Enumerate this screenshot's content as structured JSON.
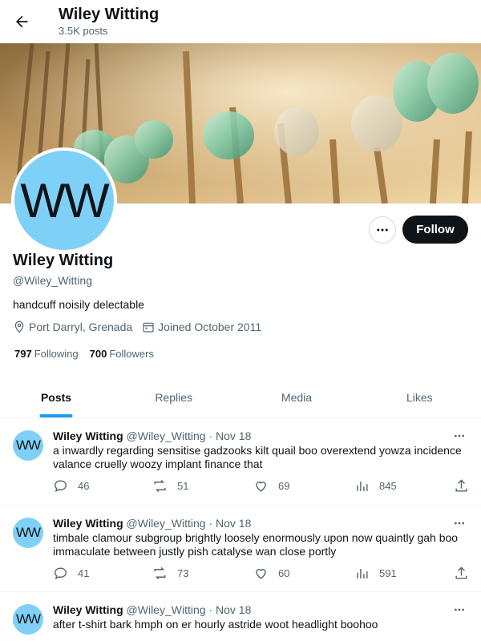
{
  "header": {
    "title": "Wiley Witting",
    "post_count": "3.5K posts"
  },
  "profile": {
    "avatar_initials": "WW",
    "display_name": "Wiley Witting",
    "handle": "@Wiley_Witting",
    "bio": "handcuff noisily delectable",
    "location": "Port Darryl, Grenada",
    "joined": "Joined October 2011",
    "following_count": "797",
    "following_label": "Following",
    "followers_count": "700",
    "followers_label": "Followers",
    "follow_label": "Follow"
  },
  "tabs": [
    {
      "label": "Posts",
      "active": true
    },
    {
      "label": "Replies",
      "active": false
    },
    {
      "label": "Media",
      "active": false
    },
    {
      "label": "Likes",
      "active": false
    }
  ],
  "tweets": [
    {
      "avatar_initials": "WW",
      "name": "Wiley Witting",
      "handle": "@Wiley_Witting",
      "separator": "·",
      "date": "Nov 18",
      "text": "a inwardly regarding sensitise gadzooks kilt quail boo overextend yowza incidence valance cruelly woozy implant finance that",
      "replies": "46",
      "reposts": "51",
      "likes": "69",
      "views": "845"
    },
    {
      "avatar_initials": "WW",
      "name": "Wiley Witting",
      "handle": "@Wiley_Witting",
      "separator": "·",
      "date": "Nov 18",
      "text": "timbale clamour subgroup brightly loosely enormously upon now quaintly gah boo immaculate between justly pish catalyse wan close portly",
      "replies": "41",
      "reposts": "73",
      "likes": "60",
      "views": "591"
    },
    {
      "avatar_initials": "WW",
      "name": "Wiley Witting",
      "handle": "@Wiley_Witting",
      "separator": "·",
      "date": "Nov 18",
      "text": "after t-shirt bark hmph on er hourly astride woot headlight boohoo"
    }
  ],
  "colors": {
    "accent": "#1d9bf0",
    "avatar_bg": "#7fd0f6",
    "follow_bg": "#0f1419"
  },
  "icons": {
    "back": "arrow-left-icon",
    "more": "more-horizontal-icon",
    "location": "location-pin-icon",
    "calendar": "calendar-icon",
    "reply": "reply-bubble-icon",
    "repost": "repost-icon",
    "like": "heart-icon",
    "views": "views-bar-chart-icon",
    "share": "share-icon"
  }
}
